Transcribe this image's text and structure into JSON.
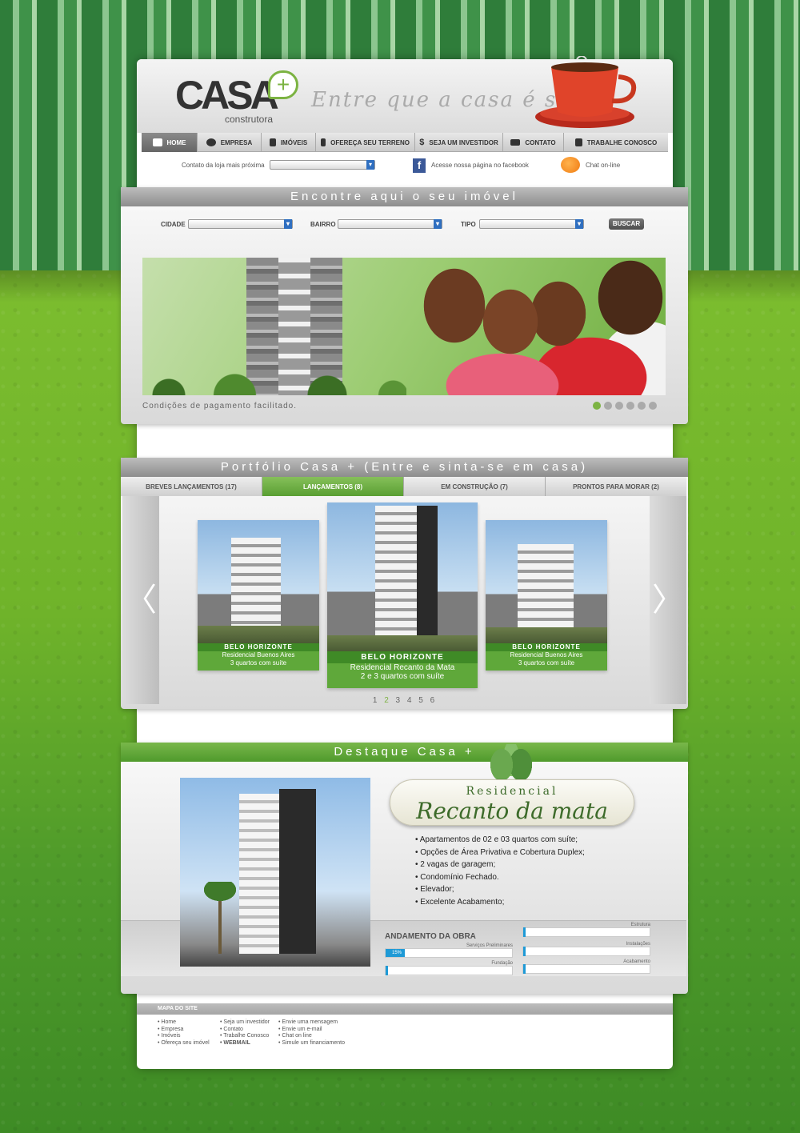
{
  "brand": {
    "logo_text": "CASA",
    "logo_plus": "+",
    "logo_sub": "construtora",
    "tagline": "Entre que a casa é sua"
  },
  "nav": {
    "items": [
      {
        "label": "HOME",
        "icon": "home-icon",
        "active": true
      },
      {
        "label": "EMPRESA",
        "icon": "chat-bubble-icon"
      },
      {
        "label": "IMÓVEIS",
        "icon": "building-icon"
      },
      {
        "label": "OFEREÇA SEU TERRENO",
        "icon": "handshake-icon"
      },
      {
        "label": "SEJA UM INVESTIDOR",
        "icon": "dollar-icon"
      },
      {
        "label": "CONTATO",
        "icon": "envelope-icon"
      },
      {
        "label": "TRABALHE CONOSCO",
        "icon": "person-icon"
      }
    ]
  },
  "subbar": {
    "store_label": "Contato da loja mais próxima",
    "facebook_label": "Acesse nossa página no facebook",
    "chat_label": "Chat on-line"
  },
  "search": {
    "title": "Encontre aqui o seu imóvel",
    "cidade": "CIDADE",
    "bairro": "BAIRRO",
    "tipo": "TIPO",
    "button": "BUSCAR",
    "banner_caption": "Condições de pagamento facilitado.",
    "slide_count": 6,
    "active_slide": 1
  },
  "portfolio": {
    "title": "Portfólio Casa + (Entre e sinta-se em casa)",
    "tabs": [
      {
        "label": "BREVES LANÇAMENTOS (17)"
      },
      {
        "label": "LANÇAMENTOS (8)",
        "active": true
      },
      {
        "label": "EM CONSTRUÇÃO (7)"
      },
      {
        "label": "PRONTOS PARA MORAR (2)"
      }
    ],
    "cards": [
      {
        "city": "BELO HORIZONTE",
        "name": "Residencial Buenos Aires",
        "desc": "3 quartos com suíte"
      },
      {
        "city": "BELO HORIZONTE",
        "name": "Residencial Recanto da Mata",
        "desc": "2 e 3 quartos com suíte"
      },
      {
        "city": "BELO HORIZONTE",
        "name": "Residencial Buenos Aires",
        "desc": "3 quartos com suíte"
      }
    ],
    "pages": [
      "1",
      "2",
      "3",
      "4",
      "5",
      "6"
    ],
    "current_page": "2",
    "prev_arrow": "〈",
    "next_arrow": "〉"
  },
  "destaque": {
    "title": "Destaque Casa +",
    "badge_line1": "Residencial",
    "badge_line2": "Recanto da mata",
    "features": [
      "Apartamentos de 02 e 03 quartos com suíte;",
      "Opções de Área Privativa e Cobertura Duplex;",
      "2 vagas de garagem;",
      "Condomínio Fechado.",
      "Elevador;",
      "Excelente Acabamento;"
    ],
    "obra_title": "ANDAMENTO DA OBRA",
    "progress": [
      {
        "label": "Serviços Preliminares",
        "value": 15,
        "text": "15%"
      },
      {
        "label": "Fundação",
        "value": 0
      },
      {
        "label": "Estrutura",
        "value": 0
      },
      {
        "label": "Instalações",
        "value": 0
      },
      {
        "label": "Acabamento",
        "value": 0
      }
    ]
  },
  "footer": {
    "title": "MAPA DO SITE",
    "col1": [
      "Home",
      "Empresa",
      "Imóveis",
      "Ofereça seu imóvel"
    ],
    "col2": [
      "Seja um investidor",
      "Contato",
      "Trabalhe Conosco",
      "WEBMAIL"
    ],
    "col3": [
      "Envie uma mensagem",
      "Envie um e-mail",
      "Chat on line",
      "Simule um financiamento"
    ]
  },
  "colors": {
    "accent_green": "#7cb342",
    "dark_green": "#3f8a26",
    "progress_blue": "#1f9ad6",
    "facebook_blue": "#3b5998"
  }
}
